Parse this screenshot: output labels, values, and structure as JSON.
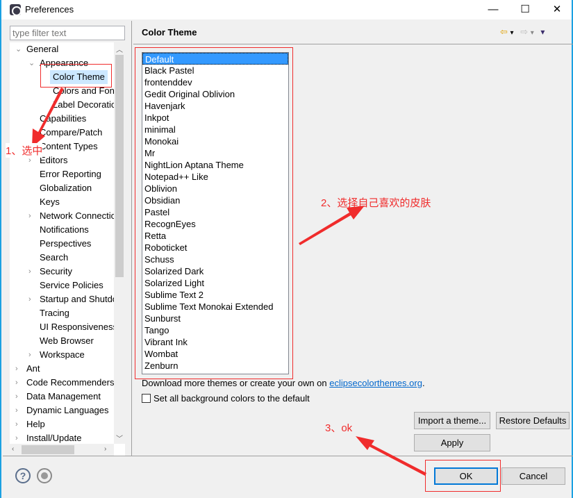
{
  "window": {
    "title": "Preferences",
    "minimize": "—",
    "maximize": "☐",
    "close": "✕"
  },
  "filter": {
    "placeholder": "type filter text"
  },
  "tree": [
    {
      "label": "General",
      "level": 0,
      "tw": "⌄"
    },
    {
      "label": "Appearance",
      "level": 1,
      "tw": "⌄"
    },
    {
      "label": "Color Theme",
      "level": 2,
      "tw": "",
      "selected": true
    },
    {
      "label": "Colors and Fonts",
      "level": 2,
      "tw": ""
    },
    {
      "label": "Label Decorations",
      "level": 2,
      "tw": ""
    },
    {
      "label": "Capabilities",
      "level": 1,
      "tw": ""
    },
    {
      "label": "Compare/Patch",
      "level": 1,
      "tw": ""
    },
    {
      "label": "Content Types",
      "level": 1,
      "tw": ""
    },
    {
      "label": "Editors",
      "level": 1,
      "tw": "›"
    },
    {
      "label": "Error Reporting",
      "level": 1,
      "tw": ""
    },
    {
      "label": "Globalization",
      "level": 1,
      "tw": ""
    },
    {
      "label": "Keys",
      "level": 1,
      "tw": ""
    },
    {
      "label": "Network Connections",
      "level": 1,
      "tw": "›"
    },
    {
      "label": "Notifications",
      "level": 1,
      "tw": ""
    },
    {
      "label": "Perspectives",
      "level": 1,
      "tw": ""
    },
    {
      "label": "Search",
      "level": 1,
      "tw": ""
    },
    {
      "label": "Security",
      "level": 1,
      "tw": "›"
    },
    {
      "label": "Service Policies",
      "level": 1,
      "tw": ""
    },
    {
      "label": "Startup and Shutdown",
      "level": 1,
      "tw": "›"
    },
    {
      "label": "Tracing",
      "level": 1,
      "tw": ""
    },
    {
      "label": "UI Responsiveness",
      "level": 1,
      "tw": ""
    },
    {
      "label": "Web Browser",
      "level": 1,
      "tw": ""
    },
    {
      "label": "Workspace",
      "level": 1,
      "tw": "›"
    },
    {
      "label": "Ant",
      "level": 0,
      "tw": "›"
    },
    {
      "label": "Code Recommenders",
      "level": 0,
      "tw": "›"
    },
    {
      "label": "Data Management",
      "level": 0,
      "tw": "›"
    },
    {
      "label": "Dynamic Languages",
      "level": 0,
      "tw": "›"
    },
    {
      "label": "Help",
      "level": 0,
      "tw": "›"
    },
    {
      "label": "Install/Update",
      "level": 0,
      "tw": "›"
    }
  ],
  "page": {
    "title": "Color Theme",
    "nav": {
      "back": "⇦",
      "forward": "⇨",
      "menu": "▾"
    }
  },
  "themes": [
    "Default",
    "Black Pastel",
    "frontenddev",
    "Gedit Original Oblivion",
    "Havenjark",
    "Inkpot",
    "minimal",
    "Monokai",
    "Mr",
    "NightLion Aptana Theme",
    "Notepad++ Like",
    "Oblivion",
    "Obsidian",
    "Pastel",
    "RecognEyes",
    "Retta",
    "Roboticket",
    "Schuss",
    "Solarized Dark",
    "Solarized Light",
    "Sublime Text 2",
    "Sublime Text Monokai Extended",
    "Sunburst",
    "Tango",
    "Vibrant Ink",
    "Wombat",
    "Zenburn"
  ],
  "selected_theme": "Default",
  "download": {
    "text": "Download more themes or create your own on ",
    "link": "eclipsecolorthemes.org",
    "suffix": "."
  },
  "checkbox": {
    "label": "Set all background colors to the default",
    "checked": false
  },
  "buttons": {
    "import": "Import a theme...",
    "restore": "Restore Defaults",
    "apply": "Apply",
    "ok": "OK",
    "cancel": "Cancel"
  },
  "footer": {
    "help": "?"
  },
  "annotations": {
    "step1": "1、选中",
    "step2": "2、选择自己喜欢的皮肤",
    "step3": "3、ok",
    "color": "#f02c2c"
  }
}
